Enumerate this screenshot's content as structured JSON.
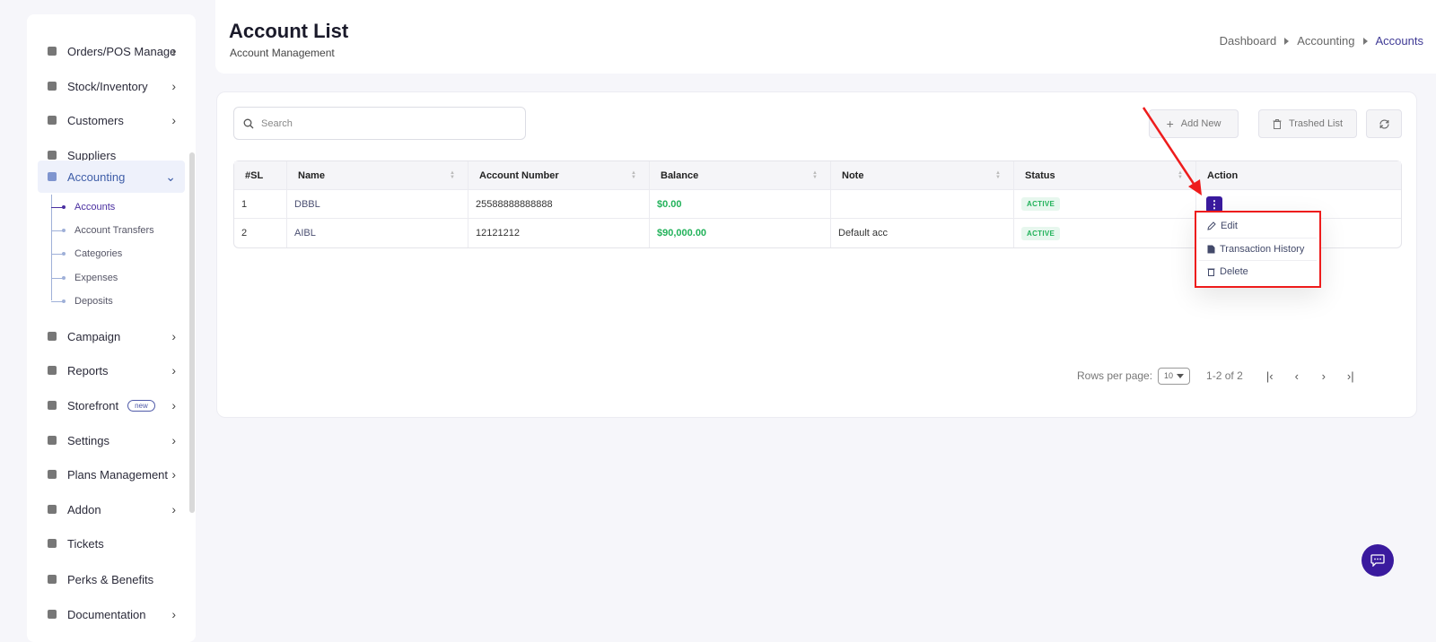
{
  "sidebar": {
    "items": [
      {
        "label": "Orders/POS Manage",
        "icon": "orders-icon",
        "chevron": true
      },
      {
        "label": "Stock/Inventory",
        "icon": "inventory-icon",
        "chevron": true
      },
      {
        "label": "Customers",
        "icon": "customers-icon",
        "chevron": true
      },
      {
        "label": "Suppliers",
        "icon": "suppliers-icon",
        "chevron": false
      },
      {
        "label": "Accounting",
        "icon": "accounting-icon",
        "chevron": true,
        "expanded": true,
        "active": true
      },
      {
        "label": "Campaign",
        "icon": "campaign-icon",
        "chevron": true
      },
      {
        "label": "Reports",
        "icon": "reports-icon",
        "chevron": true
      },
      {
        "label": "Storefront",
        "icon": "storefront-icon",
        "chevron": true,
        "badge": "new"
      },
      {
        "label": "Settings",
        "icon": "settings-icon",
        "chevron": true
      },
      {
        "label": "Plans Management",
        "icon": "plans-icon",
        "chevron": true
      },
      {
        "label": "Addon",
        "icon": "addon-icon",
        "chevron": true
      },
      {
        "label": "Tickets",
        "icon": "tickets-icon",
        "chevron": false
      },
      {
        "label": "Perks & Benefits",
        "icon": "perks-icon",
        "chevron": false
      },
      {
        "label": "Documentation",
        "icon": "documentation-icon",
        "chevron": true
      }
    ],
    "accounting_sub": [
      "Accounts",
      "Account Transfers",
      "Categories",
      "Expenses",
      "Deposits"
    ],
    "active_sub": "Accounts"
  },
  "header": {
    "title": "Account List",
    "subtitle": "Account Management",
    "breadcrumb": [
      "Dashboard",
      "Accounting",
      "Accounts"
    ]
  },
  "toolbar": {
    "search_placeholder": "Search",
    "add_new": "Add New",
    "trashed_list": "Trashed List"
  },
  "table": {
    "columns": [
      "#SL",
      "Name",
      "Account Number",
      "Balance",
      "Note",
      "Status",
      "Action"
    ],
    "rows": [
      {
        "sl": "1",
        "name": "DBBL",
        "account_number": "25588888888888",
        "balance": "$0.00",
        "note": "",
        "status": "ACTIVE"
      },
      {
        "sl": "2",
        "name": "AIBL",
        "account_number": "12121212",
        "balance": "$90,000.00",
        "note": "Default acc",
        "status": "ACTIVE"
      }
    ]
  },
  "action_menu": {
    "items": [
      "Edit",
      "Transaction History",
      "Delete"
    ]
  },
  "pagination": {
    "rows_per_page_label": "Rows per page:",
    "rows_per_page": "10",
    "range": "1-2 of 2"
  },
  "colors": {
    "primary": "#3a1a9e",
    "active_status": "#22b25a",
    "annotation": "#ee1c1c"
  }
}
